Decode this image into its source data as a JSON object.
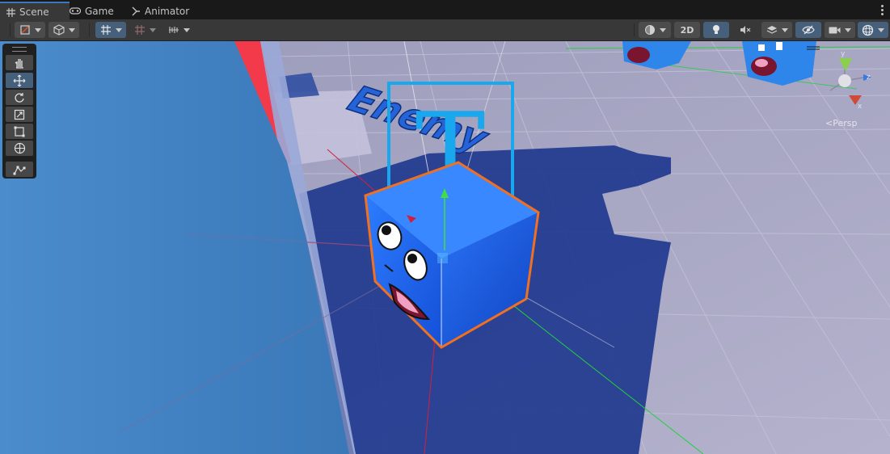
{
  "tabs": [
    {
      "label": "Scene",
      "icon": "grid-icon",
      "active": true
    },
    {
      "label": "Game",
      "icon": "gamepad-icon",
      "active": false
    },
    {
      "label": "Animator",
      "icon": "animator-icon",
      "active": false
    }
  ],
  "toolbar": {
    "mode_2d_label": "2D"
  },
  "tools": [
    "hand-tool",
    "move-tool",
    "rotate-tool",
    "scale-tool",
    "rect-tool",
    "transform-tool",
    "custom-tool"
  ],
  "scene": {
    "sign_text": "Enemy",
    "sign_icon_letter": "T"
  },
  "gizmo": {
    "projection_label": "Persp",
    "axis_x": "x",
    "axis_y": "y",
    "axis_z": "z"
  },
  "colors": {
    "accent": "#3a79bb",
    "cube": "#1f6ef5",
    "selection_outline": "#f07020",
    "ground": "#a9a9c9"
  }
}
